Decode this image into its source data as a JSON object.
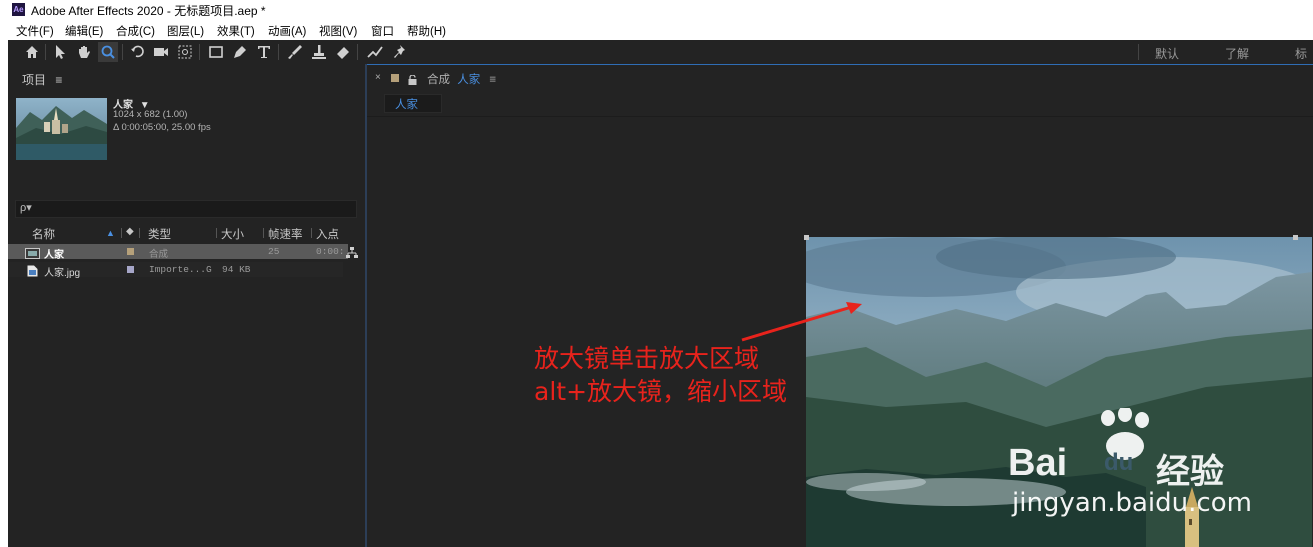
{
  "window": {
    "app_icon": "Ae",
    "title": "Adobe After Effects 2020 - 无标题项目.aep *"
  },
  "menu": [
    "文件(F)",
    "编辑(E)",
    "合成(C)",
    "图层(L)",
    "效果(T)",
    "动画(A)",
    "视图(V)",
    "窗口",
    "帮助(H)"
  ],
  "toolbar": {
    "tools": [
      "home-icon",
      "selection-icon",
      "hand-icon",
      "zoom-icon",
      "rotate-icon",
      "camera-icon",
      "pan-behind-icon",
      "rectangle-icon",
      "pen-icon",
      "type-icon",
      "brush-icon",
      "clone-stamp-icon",
      "eraser-icon",
      "roto-brush-icon",
      "puppet-pin-icon"
    ],
    "active_tool": "zoom-icon",
    "workspaces": [
      "默认",
      "了解",
      "标"
    ]
  },
  "project_panel": {
    "title": "项目",
    "menu_glyph": "≡",
    "selected_item": {
      "name": "人家",
      "dropdown": "▼",
      "dimensions": "1024 x 682 (1.00)",
      "duration": "Δ 0:00:05:00, 25.00 fps"
    },
    "search_glyph": "ρ▾",
    "columns": [
      "名称",
      "类型",
      "大小",
      "帧速率",
      "入点"
    ],
    "items": [
      {
        "name": "人家",
        "type": "合成",
        "size": "",
        "fps": "25",
        "in": "0:00:",
        "swatch": "#b5a07a",
        "selected": true
      },
      {
        "name": "人家.jpg",
        "type": "Importe...G",
        "size": "94 KB",
        "fps": "",
        "in": "",
        "swatch": "#a6a6c8",
        "selected": false
      }
    ]
  },
  "comp_panel": {
    "close": "×",
    "lock": "🔓",
    "label": "合成",
    "comp_name": "人家",
    "menu_glyph": "≡",
    "breadcrumb": "人家"
  },
  "annotation": {
    "line1": "放大镜单击放大区域",
    "line2": "alt+放大镜，缩小区域",
    "color": "#e8231c"
  },
  "watermark": {
    "brand_a": "Bai",
    "brand_b": "du",
    "brand_c": "经验",
    "url": "jingyan.baidu.com"
  },
  "colors": {
    "panel": "#232323",
    "accent": "#2f6db5",
    "link": "#4a90e2"
  }
}
